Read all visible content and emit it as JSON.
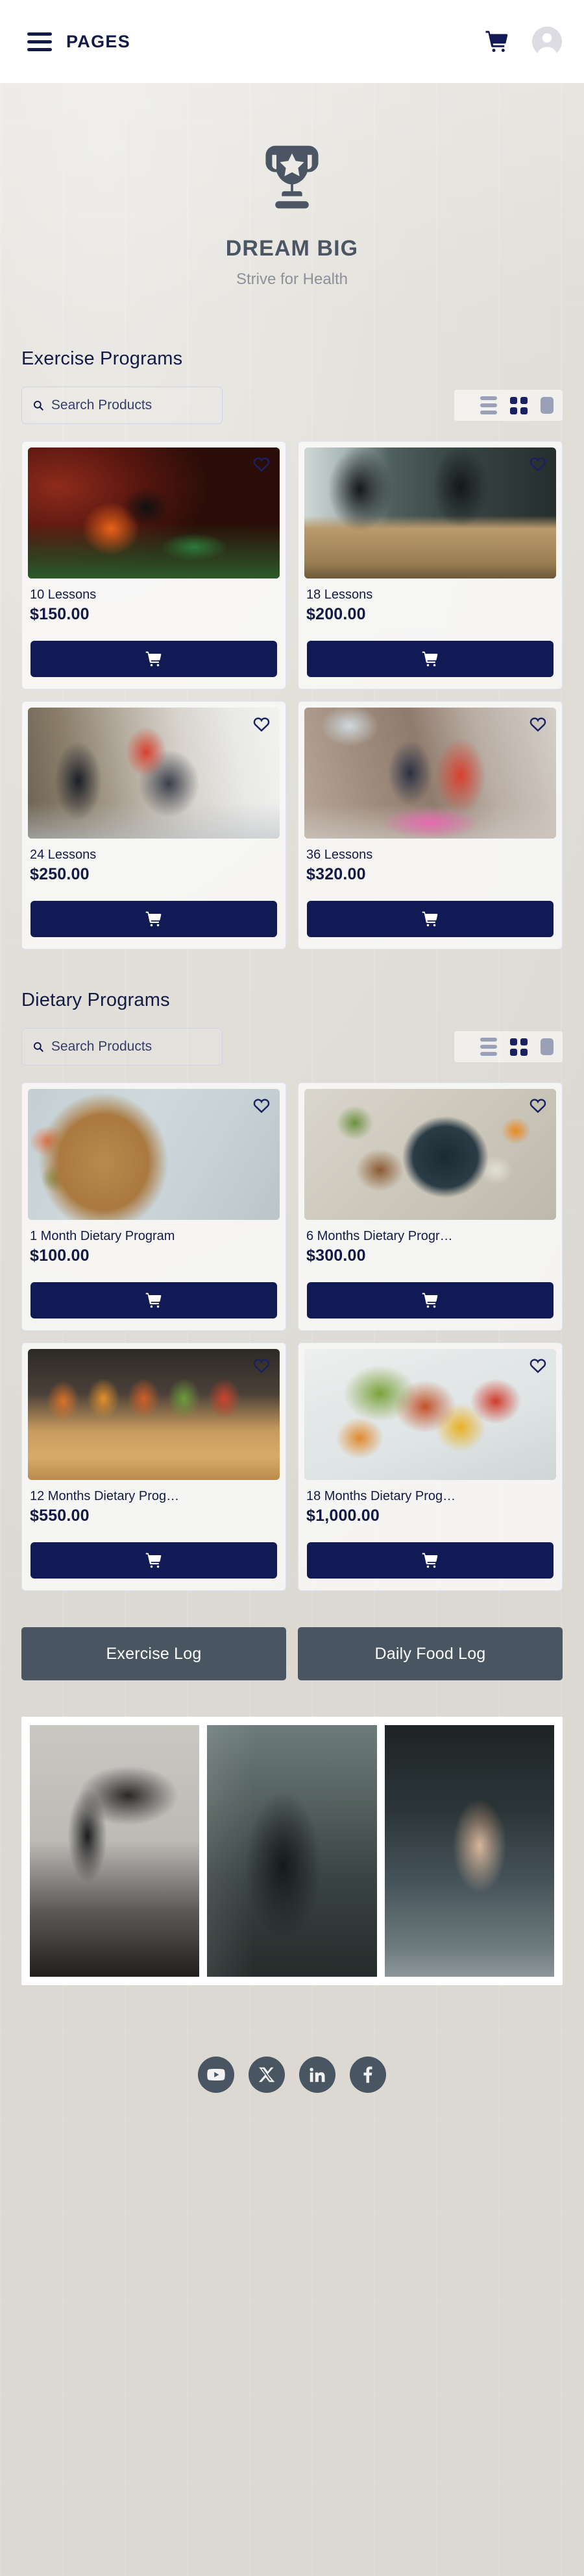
{
  "header": {
    "menu_label": "PAGES",
    "menu_icon": "hamburger-icon",
    "cart_icon": "shopping-cart-icon",
    "avatar_icon": "user-avatar-placeholder"
  },
  "hero": {
    "logo_icon": "trophy-icon",
    "title": "DREAM BIG",
    "subtitle": "Strive for Health"
  },
  "exercise_section": {
    "title": "Exercise Programs",
    "search_placeholder": "Search Products",
    "search_value": "",
    "search_icon": "search-icon",
    "view_modes": [
      {
        "name": "list-view",
        "icon": "list-view-icon",
        "active": false
      },
      {
        "name": "grid-view",
        "icon": "grid-view-icon",
        "active": true
      },
      {
        "name": "single-view",
        "icon": "single-column-view-icon",
        "active": false
      }
    ],
    "products": [
      {
        "title": "10 Lessons",
        "price": "$150.00",
        "favorite_icon": "heart-icon",
        "cart_icon": "shopping-cart-icon",
        "image": "trainer-coaching-pushups"
      },
      {
        "title": "18 Lessons",
        "price": "$200.00",
        "favorite_icon": "heart-icon",
        "cart_icon": "shopping-cart-icon",
        "image": "box-jump-training"
      },
      {
        "title": "24 Lessons",
        "price": "$250.00",
        "favorite_icon": "heart-icon",
        "cart_icon": "shopping-cart-icon",
        "image": "partner-plank-high-five"
      },
      {
        "title": "36 Lessons",
        "price": "$320.00",
        "favorite_icon": "heart-icon",
        "cart_icon": "shopping-cart-icon",
        "image": "partner-situps-yoga-mat"
      }
    ]
  },
  "dietary_section": {
    "title": "Dietary Programs",
    "search_placeholder": "Search Products",
    "search_value": "",
    "search_icon": "search-icon",
    "view_modes": [
      {
        "name": "list-view",
        "icon": "list-view-icon",
        "active": false
      },
      {
        "name": "grid-view",
        "icon": "grid-view-icon",
        "active": true
      },
      {
        "name": "single-view",
        "icon": "single-column-view-icon",
        "active": false
      }
    ],
    "products": [
      {
        "title": "1 Month Dietary Program",
        "price": "$100.00",
        "favorite_icon": "heart-icon",
        "cart_icon": "shopping-cart-icon",
        "image": "salad-bowls-wooden-board"
      },
      {
        "title": "6 Months Dietary Progr…",
        "price": "$300.00",
        "favorite_icon": "heart-icon",
        "cart_icon": "shopping-cart-icon",
        "image": "fruit-bowl-avocado-toast"
      },
      {
        "title": "12 Months Dietary Prog…",
        "price": "$550.00",
        "favorite_icon": "heart-icon",
        "cart_icon": "shopping-cart-icon",
        "image": "vegetable-juice-glasses"
      },
      {
        "title": "18 Months Dietary Prog…",
        "price": "$1,000.00",
        "favorite_icon": "heart-icon",
        "cart_icon": "shopping-cart-icon",
        "image": "grilled-salmon-vegetables"
      }
    ]
  },
  "logs": {
    "exercise_log_label": "Exercise Log",
    "food_log_label": "Daily Food Log"
  },
  "gallery": {
    "items": [
      {
        "name": "battle-ropes-workout"
      },
      {
        "name": "barbell-squat-rack"
      },
      {
        "name": "athlete-sit-up-gym"
      }
    ]
  },
  "footer": {
    "social": [
      {
        "name": "youtube",
        "icon": "youtube-icon"
      },
      {
        "name": "x-twitter",
        "icon": "x-icon"
      },
      {
        "name": "linkedin",
        "icon": "linkedin-icon"
      },
      {
        "name": "facebook",
        "icon": "facebook-icon"
      }
    ]
  },
  "colors": {
    "navy": "#121a56",
    "slate": "#4a5562",
    "page_bg": "#e4e1dc",
    "card_bg": "#fafafa"
  }
}
